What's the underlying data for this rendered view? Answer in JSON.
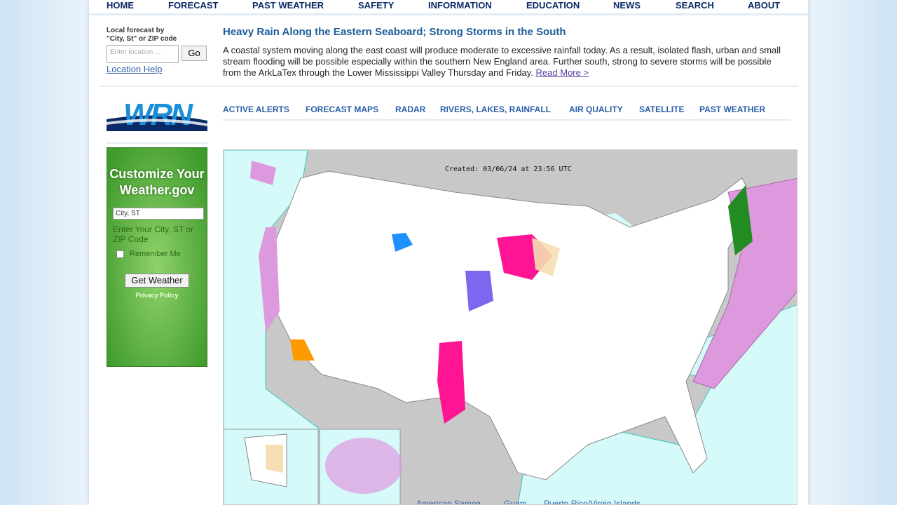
{
  "top_nav": [
    "HOME",
    "FORECAST",
    "PAST WEATHER",
    "SAFETY",
    "INFORMATION",
    "EDUCATION",
    "NEWS",
    "SEARCH",
    "ABOUT"
  ],
  "local_forecast": {
    "label_line1": "Local forecast by",
    "label_line2": "\"City, St\" or ZIP code",
    "placeholder": "Enter location ...",
    "go": "Go",
    "help": "Location Help"
  },
  "news": {
    "headline": "Heavy Rain Along the Eastern Seaboard; Strong Storms in the South",
    "body": "A coastal system moving along the east coast will produce moderate to excessive rainfall today. As a result, isolated flash, urban and small stream flooding will be possible especially within the southern New England area. Further south, strong to severe storms will be possible from the ArkLaTex through the Lower Mississippi Valley Thursday and Friday. ",
    "read_more": "Read More >"
  },
  "logo": "WRN",
  "sub_nav": [
    "ACTIVE ALERTS",
    "FORECAST MAPS",
    "RADAR",
    "RIVERS, LAKES, RAINFALL",
    "AIR QUALITY",
    "SATELLITE",
    "PAST WEATHER"
  ],
  "customize": {
    "title": "Customize Your Weather.gov",
    "input_value": "City, ST",
    "hint": "Enter Your City, ST or ZIP Code",
    "remember": "Remember Me",
    "button": "Get Weather",
    "privacy": "Privacy Policy"
  },
  "map": {
    "created": "Created: 03/06/24 at 23:56 UTC",
    "territories": [
      "American Samoa",
      "Guam",
      "Puerto Rico/Virgin Islands"
    ],
    "colors": {
      "ocean": "#d6fafa",
      "land": "#ffffff",
      "marine_warning": "#dd99dd",
      "winter_storm": "#ff1493",
      "winter_weather": "#7b68ee",
      "freeze": "#f5deb3",
      "flood": "#228b22"
    }
  }
}
